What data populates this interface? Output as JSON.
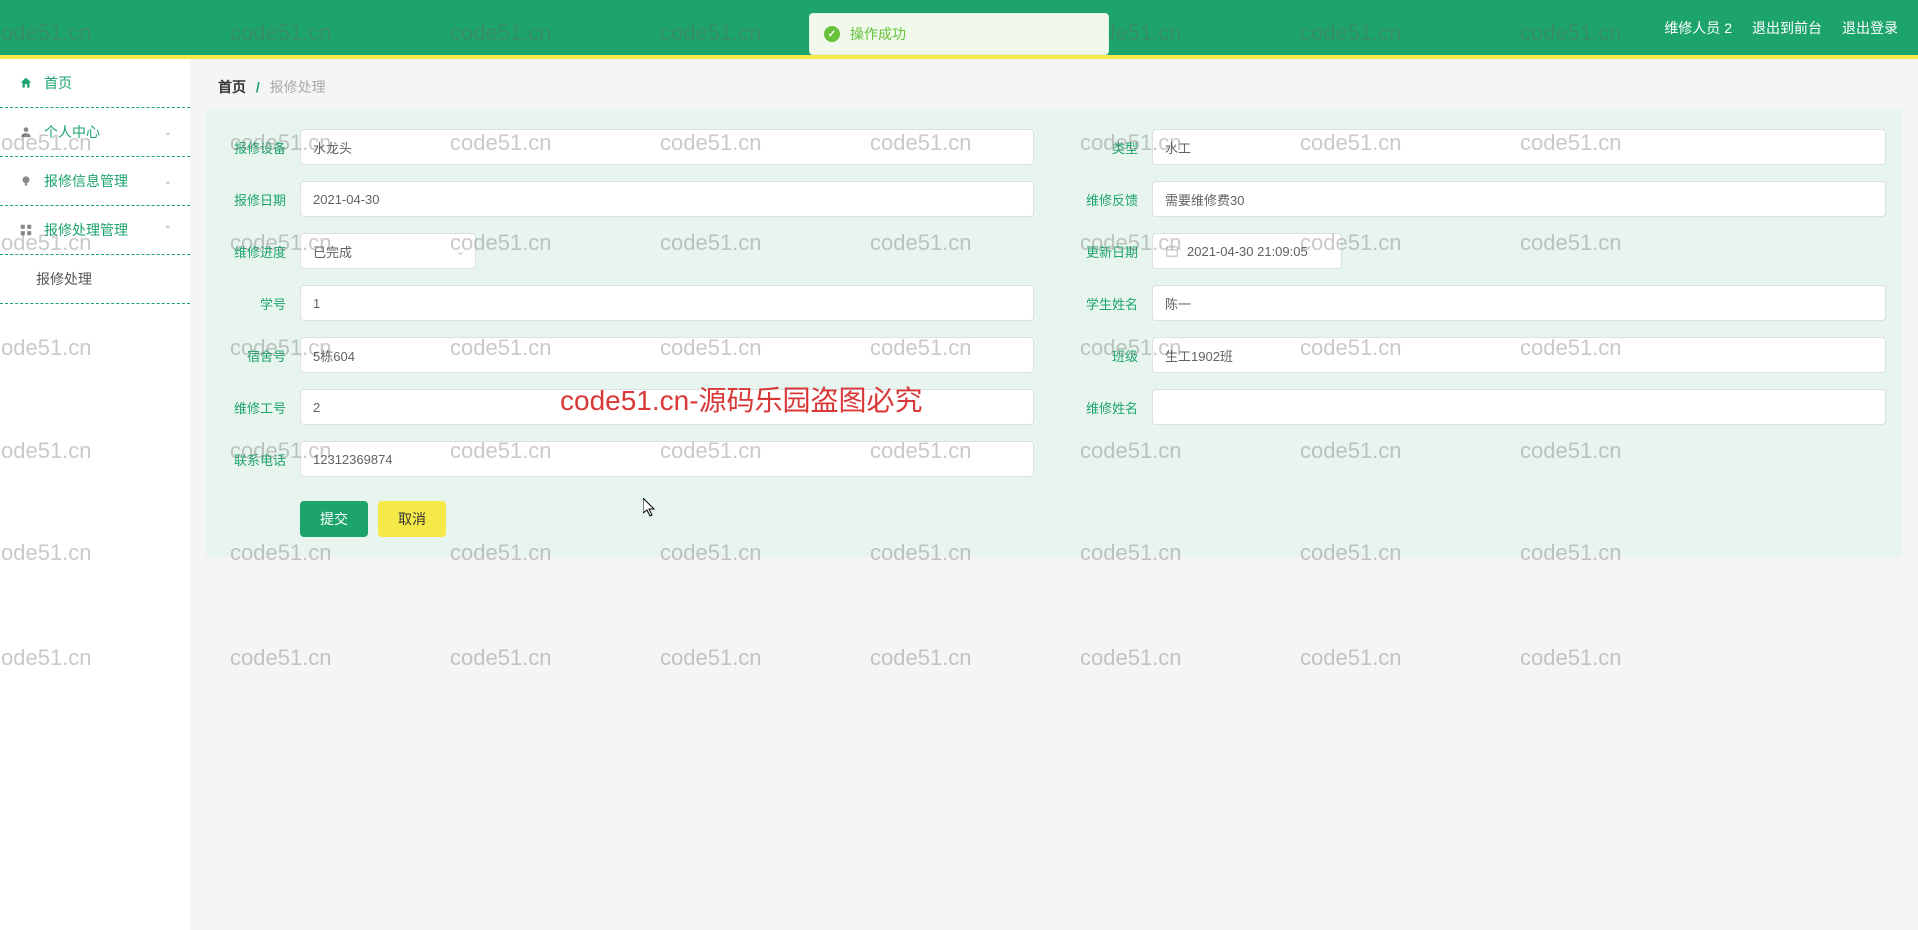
{
  "header": {
    "user": "维修人员 2",
    "link_front": "退出到前台",
    "link_logout": "退出登录"
  },
  "toast": {
    "text": "操作成功"
  },
  "sidebar": {
    "home": "首页",
    "personal": "个人中心",
    "repair_info": "报修信息管理",
    "repair_process": "报修处理管理",
    "repair_process_sub": "报修处理"
  },
  "breadcrumb": {
    "home": "首页",
    "current": "报修处理"
  },
  "form": {
    "labels": {
      "device": "报修设备",
      "type": "类型",
      "date": "报修日期",
      "feedback": "维修反馈",
      "progress": "维修进度",
      "update": "更新日期",
      "studentno": "学号",
      "studentname": "学生姓名",
      "dorm": "宿舍号",
      "class": "班级",
      "workerno": "维修工号",
      "workername": "维修姓名",
      "phone": "联系电话"
    },
    "values": {
      "device": "水龙头",
      "type": "水工",
      "date": "2021-04-30",
      "feedback": "需要维修费30",
      "progress": "已完成",
      "update": "2021-04-30 21:09:05",
      "studentno": "1",
      "studentname": "陈一",
      "dorm": "5栋604",
      "class": "生工1902班",
      "workerno": "2",
      "workername": "",
      "phone": "12312369874"
    }
  },
  "buttons": {
    "submit": "提交",
    "cancel": "取消"
  },
  "watermark": {
    "text": "code51.cn",
    "red": "code51.cn-源码乐园盗图必究"
  }
}
